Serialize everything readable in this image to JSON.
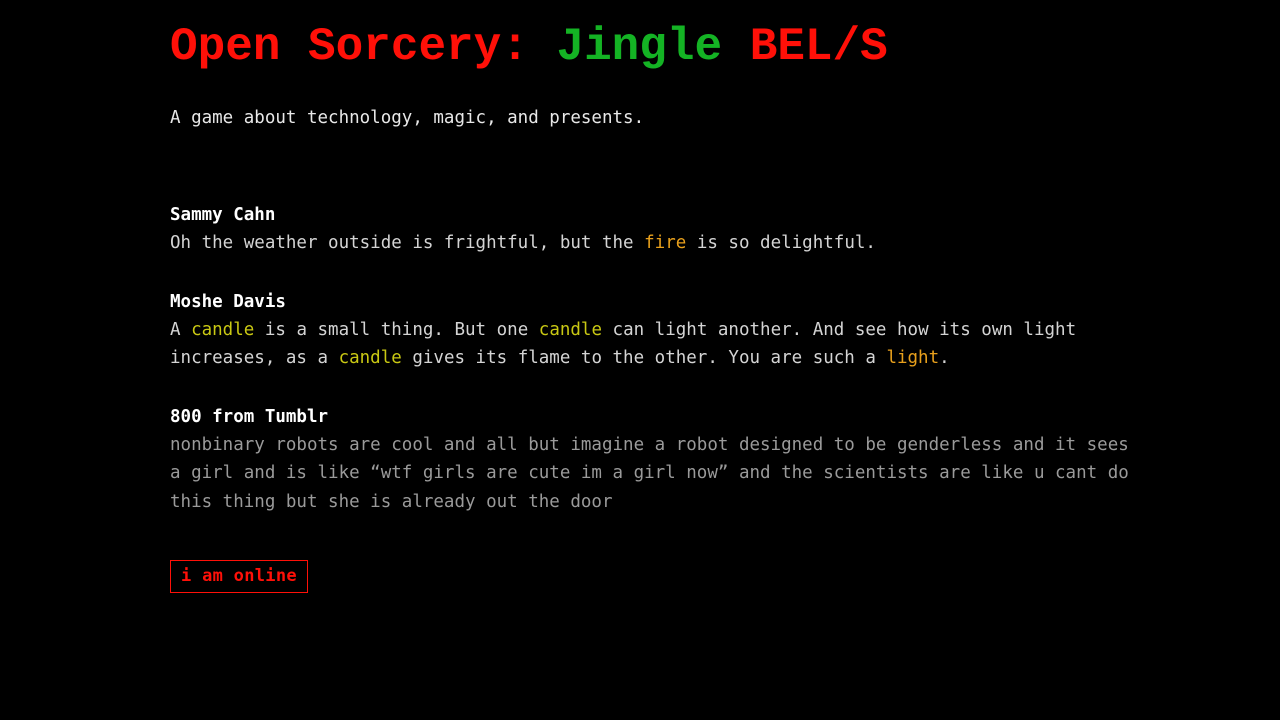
{
  "page": {
    "background_color": "#000000",
    "title_red": "#ff1008",
    "title_green": "#14b324",
    "keyword_orange": "#e8a01c",
    "keyword_yellow": "#c9c813",
    "body_color": "#d4d4d4",
    "dim_body_color": "#9a9a9a"
  },
  "header": {
    "title_part1": "Open Sorcery: ",
    "title_part2": "Jingle",
    "title_part3": " BEL/S",
    "subtitle": "A game about technology, magic, and presents."
  },
  "log": {
    "entries": [
      {
        "speaker": "Sammy Cahn",
        "body_segments": [
          {
            "text": "Oh the weather outside is frightful, but the ",
            "style": "normal"
          },
          {
            "text": "fire",
            "style": "orange"
          },
          {
            "text": " is so delightful.",
            "style": "normal"
          }
        ],
        "dim": false
      },
      {
        "speaker": "Moshe Davis",
        "body_segments": [
          {
            "text": "A ",
            "style": "normal"
          },
          {
            "text": "candle",
            "style": "yellow"
          },
          {
            "text": " is a small thing. But one ",
            "style": "normal"
          },
          {
            "text": "candle",
            "style": "yellow"
          },
          {
            "text": " can light another. And see how its own light increases, as a ",
            "style": "normal"
          },
          {
            "text": "candle",
            "style": "yellow"
          },
          {
            "text": " gives its flame to the other. You are such a ",
            "style": "normal"
          },
          {
            "text": "light",
            "style": "orange"
          },
          {
            "text": ".",
            "style": "normal"
          }
        ],
        "dim": false
      },
      {
        "speaker": "800 from Tumblr",
        "body_segments": [
          {
            "text": "nonbinary robots are cool and all but imagine a robot designed to be genderless and it sees a girl and is like “wtf girls are cute im a girl now” and the scientists are like u cant do this thing but she is already out the door",
            "style": "normal"
          }
        ],
        "dim": true
      }
    ]
  },
  "actions": {
    "online_button_label": "i am online"
  }
}
